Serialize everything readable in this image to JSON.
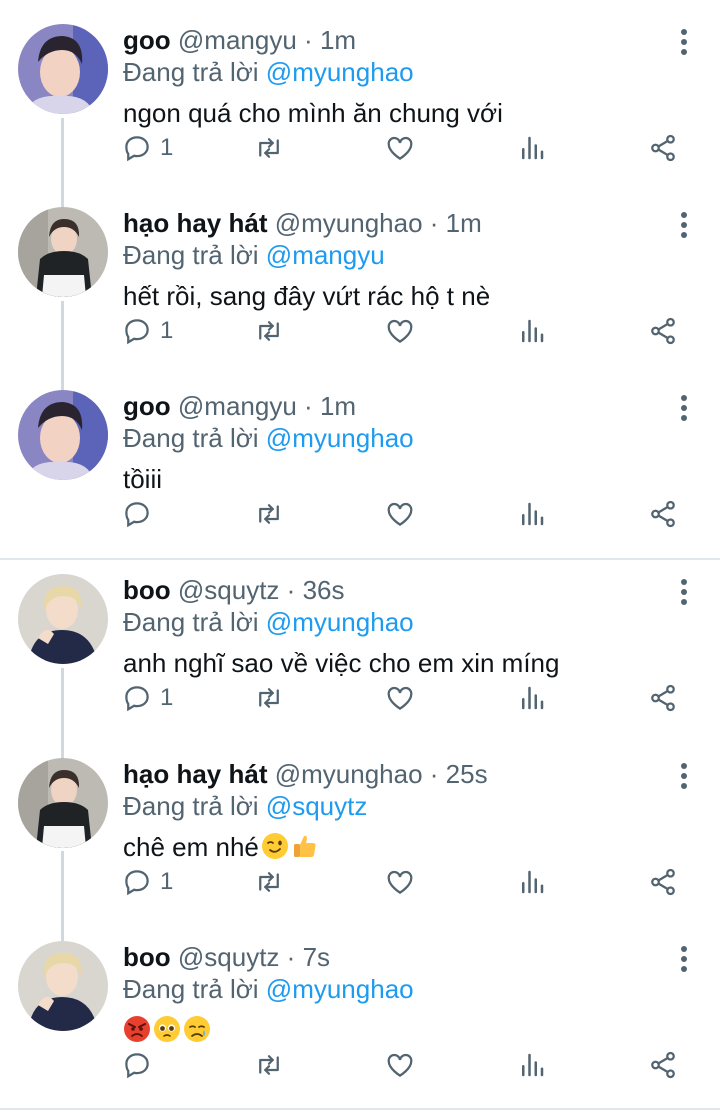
{
  "tweets": [
    {
      "name": "goo",
      "handle": "@mangyu",
      "time": "1m",
      "replying_prefix": "Đang trả lời",
      "replying_to": "@myunghao",
      "text": "ngon quá cho mình ăn chung với",
      "replies": "1",
      "avatar": "goo"
    },
    {
      "name": "hạo hay hát",
      "handle": "@myunghao",
      "time": "1m",
      "replying_prefix": "Đang trả lời",
      "replying_to": "@mangyu",
      "text": "hết rồi, sang đây vứt rác hộ t nè",
      "replies": "1",
      "avatar": "hao"
    },
    {
      "name": "goo",
      "handle": "@mangyu",
      "time": "1m",
      "replying_prefix": "Đang trả lời",
      "replying_to": "@myunghao",
      "text": "tồiii",
      "replies": "",
      "avatar": "goo"
    },
    {
      "name": "boo",
      "handle": "@squytz",
      "time": "36s",
      "replying_prefix": "Đang trả lời",
      "replying_to": "@myunghao",
      "text": "anh nghĩ sao về việc cho em xin míng",
      "replies": "1",
      "avatar": "boo"
    },
    {
      "name": "hạo hay hát",
      "handle": "@myunghao",
      "time": "25s",
      "replying_prefix": "Đang trả lời",
      "replying_to": "@squytz",
      "text": "chê em nhé",
      "emojis": [
        "wink-emoji",
        "thumbs-up-emoji"
      ],
      "replies": "1",
      "avatar": "hao"
    },
    {
      "name": "boo",
      "handle": "@squytz",
      "time": "7s",
      "replying_prefix": "Đang trả lời",
      "replying_to": "@myunghao",
      "text": "",
      "emojis": [
        "angry-emoji",
        "pleading-emoji",
        "crying-emoji"
      ],
      "replies": "",
      "avatar": "boo"
    }
  ],
  "separator": "·",
  "colors": {
    "mention": "#1d9bf0",
    "secondary_text": "#536471",
    "thread_line": "#cfd9de",
    "divider": "#e1e8ed"
  },
  "icons": [
    "more-vertical-icon",
    "reply-icon",
    "retweet-icon",
    "like-icon",
    "views-icon",
    "share-icon"
  ]
}
